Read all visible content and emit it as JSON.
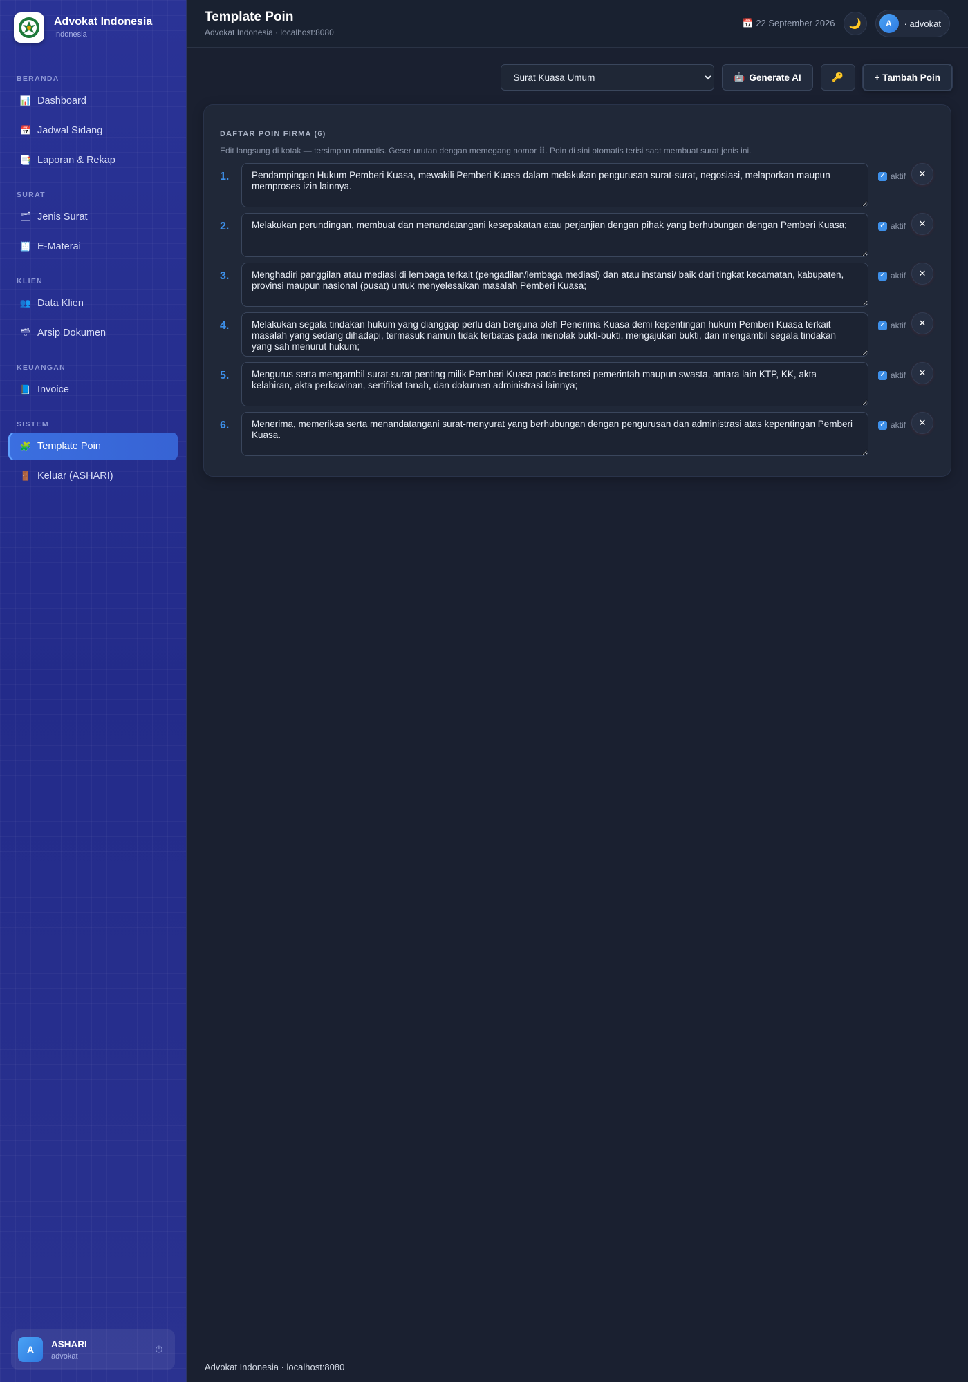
{
  "brand": {
    "title": "Advokat Indonesia",
    "subtitle": "Indonesia",
    "logo_icon": "garuda-logo-icon"
  },
  "sidebar": {
    "sections": [
      {
        "label": "BERANDA",
        "items": [
          {
            "icon": "📊",
            "icon_name": "chart-icon",
            "label": "Dashboard"
          },
          {
            "icon": "📅",
            "icon_name": "calendar-icon",
            "label": "Jadwal Sidang"
          },
          {
            "icon": "📑",
            "icon_name": "report-icon",
            "label": "Laporan & Rekap"
          }
        ]
      },
      {
        "label": "SURAT",
        "items": [
          {
            "icon": "🗂",
            "icon_name": "folder-icon",
            "label": "Jenis Surat"
          },
          {
            "icon": "🧾",
            "icon_name": "receipt-icon",
            "label": "E-Materai"
          }
        ]
      },
      {
        "label": "KLIEN",
        "items": [
          {
            "icon": "👥",
            "icon_name": "users-icon",
            "label": "Data Klien"
          },
          {
            "icon": "🗃",
            "icon_name": "archive-icon",
            "label": "Arsip Dokumen"
          }
        ]
      },
      {
        "label": "KEUANGAN",
        "items": [
          {
            "icon": "📘",
            "icon_name": "invoice-icon",
            "label": "Invoice"
          }
        ]
      },
      {
        "label": "SISTEM",
        "items": [
          {
            "icon": "🧩",
            "icon_name": "puzzle-icon",
            "label": "Template Poin",
            "active": true
          },
          {
            "icon": "🚪",
            "icon_name": "door-icon",
            "label": "Keluar (ASHARI)"
          }
        ]
      }
    ],
    "user": {
      "initial": "A",
      "name": "ASHARI",
      "role": "advokat",
      "power_icon": "⏻"
    }
  },
  "header": {
    "title": "Template Poin",
    "subtitle": "Advokat Indonesia · localhost:8080",
    "date_icon": "📅",
    "date": "22 September 2026",
    "theme_icon": "🌙",
    "user_initial": "A",
    "user_label": "· advokat"
  },
  "toolbar": {
    "select_value": "Surat Kuasa Umum",
    "generate_icon": "🤖",
    "generate_label": "Generate AI",
    "key_icon": "🔑",
    "add_label": "+ Tambah Poin"
  },
  "card": {
    "title": "DAFTAR POIN FIRMA (6)",
    "hint": "Edit langsung di kotak — tersimpan otomatis. Geser urutan dengan memegang nomor ⠿. Poin di sini otomatis terisi saat membuat surat jenis ini.",
    "active_label": "aktif",
    "delete_symbol": "✕",
    "items": [
      {
        "num": "1.",
        "text": "Pendampingan Hukum Pemberi Kuasa, mewakili Pemberi Kuasa dalam melakukan pengurusan surat-surat, negosiasi, melaporkan maupun memproses izin lainnya.",
        "active": true
      },
      {
        "num": "2.",
        "text": "Melakukan perundingan, membuat dan menandatangani kesepakatan atau perjanjian dengan pihak yang berhubungan dengan Pemberi Kuasa;",
        "active": true
      },
      {
        "num": "3.",
        "text": "Menghadiri panggilan atau mediasi di lembaga terkait (pengadilan/lembaga mediasi) dan atau instansi/ baik dari tingkat kecamatan, kabupaten, provinsi maupun nasional (pusat) untuk menyelesaikan masalah Pemberi Kuasa;",
        "active": true
      },
      {
        "num": "4.",
        "text": "Melakukan segala tindakan hukum yang dianggap perlu dan berguna oleh Penerima Kuasa demi kepentingan hukum Pemberi Kuasa terkait masalah yang sedang dihadapi, termasuk namun tidak terbatas pada menolak bukti-bukti, mengajukan bukti, dan mengambil segala tindakan yang sah menurut hukum;",
        "active": true
      },
      {
        "num": "5.",
        "text": "Mengurus serta mengambil surat-surat penting milik Pemberi Kuasa pada instansi pemerintah maupun swasta, antara lain KTP, KK, akta kelahiran, akta perkawinan, sertifikat tanah, dan dokumen administrasi lainnya;",
        "active": true
      },
      {
        "num": "6.",
        "text": "Menerima, memeriksa serta menandatangani surat-menyurat yang berhubungan dengan pengurusan dan administrasi atas kepentingan Pemberi Kuasa.",
        "active": true
      }
    ]
  },
  "footer": {
    "text": "Advokat Indonesia · localhost:8080"
  }
}
